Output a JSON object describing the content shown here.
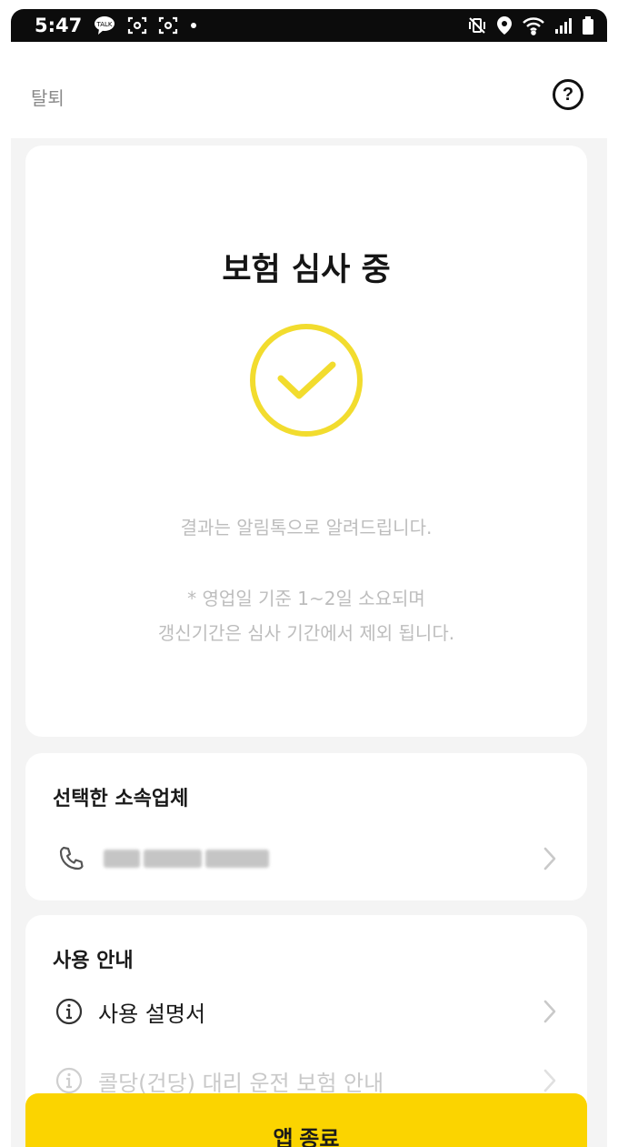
{
  "status_bar": {
    "time": "5:47",
    "left_icons": [
      "chat-bubble-icon",
      "scan-icon",
      "scan-icon",
      "dot-icon"
    ],
    "right_icons": [
      "vibrate-mute-icon",
      "location-icon",
      "wifi-icon",
      "signal-icon",
      "battery-icon"
    ]
  },
  "header": {
    "withdraw_label": "탈퇴",
    "help_label": "?"
  },
  "status_card": {
    "title": "보험 심사 중",
    "result_message": "결과는 알림톡으로 알려드립니다.",
    "note_line1": "* 영업일 기준 1~2일 소요되며",
    "note_line2": "갱신기간은 심사 기간에서 제외 됩니다."
  },
  "company_card": {
    "title": "선택한 소속업체"
  },
  "guide_card": {
    "title": "사용 안내",
    "items": [
      {
        "label": "사용 설명서"
      },
      {
        "label": "콜당(건당) 대리 운전 보험 안내"
      }
    ]
  },
  "footer": {
    "exit_label": "앱 종료"
  },
  "colors": {
    "accent_yellow": "#fbd400",
    "check_yellow": "#f2dc2e",
    "muted_text": "#bdbdbd",
    "status_bar_bg": "#0c0c0c"
  }
}
